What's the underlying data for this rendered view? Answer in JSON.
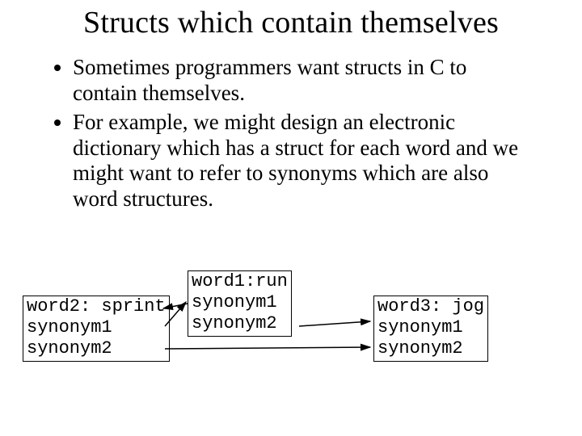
{
  "title": "Structs which contain themselves",
  "bullets": [
    "Sometimes programmers want structs in C to contain themselves.",
    "For example, we might design an electronic dictionary which has a struct for each word and we might want to refer to synonyms which are also word structures."
  ],
  "boxes": {
    "b1": {
      "l1": "word1:run",
      "l2": "synonym1",
      "l3": "synonym2"
    },
    "b2": {
      "l1": "word2: sprint",
      "l2": "synonym1",
      "l3": "synonym2"
    },
    "b3": {
      "l1": "word3: jog",
      "l2": "synonym1",
      "l3": "synonym2"
    }
  }
}
